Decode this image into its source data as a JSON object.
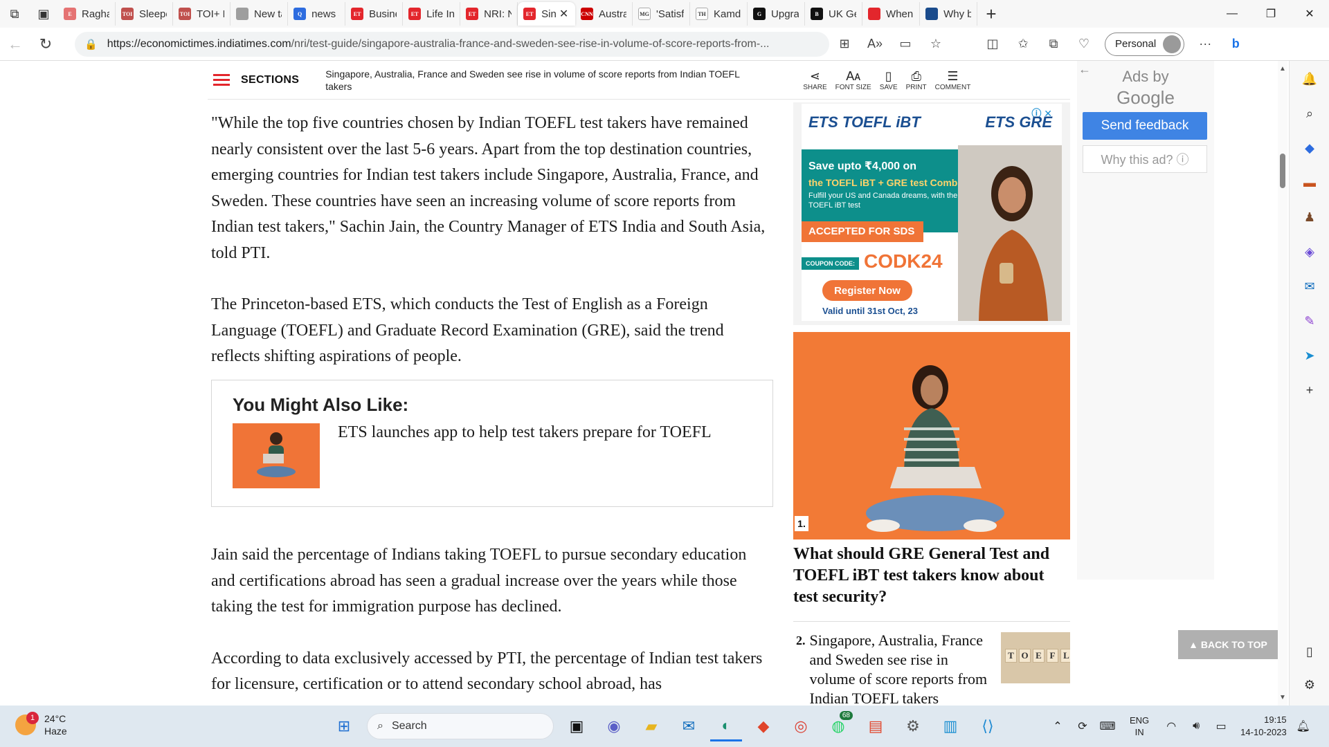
{
  "browser": {
    "tabs": [
      {
        "title": "Raghav",
        "fav_bg": "#e57373",
        "fav_text": "E"
      },
      {
        "title": "Sleeper",
        "fav_bg": "#c0504d",
        "fav_text": "TOI"
      },
      {
        "title": "TOI+ M",
        "fav_bg": "#c0504d",
        "fav_text": "TOI"
      },
      {
        "title": "New ta",
        "fav_bg": "#9e9e9e",
        "fav_text": ""
      },
      {
        "title": "news a",
        "fav_bg": "#2d6cdf",
        "fav_text": "Q"
      },
      {
        "title": "Busines",
        "fav_bg": "#e3262c",
        "fav_text": "ET"
      },
      {
        "title": "Life Ins",
        "fav_bg": "#e3262c",
        "fav_text": "ET"
      },
      {
        "title": "NRI: NF",
        "fav_bg": "#e3262c",
        "fav_text": "ET"
      },
      {
        "title": "Sin",
        "fav_bg": "#e3262c",
        "fav_text": "ET",
        "active": true
      },
      {
        "title": "Austral",
        "fav_bg": "#cc0000",
        "fav_text": "CNN"
      },
      {
        "title": "'Satisfa",
        "fav_bg": "#ffffff",
        "fav_text": "MG"
      },
      {
        "title": "Kamdu",
        "fav_bg": "#ffffff",
        "fav_text": "TH"
      },
      {
        "title": "Upgrac",
        "fav_bg": "#111111",
        "fav_text": "G"
      },
      {
        "title": "UK Geo",
        "fav_bg": "#111111",
        "fav_text": "B"
      },
      {
        "title": "When Z",
        "fav_bg": "#e3262c",
        "fav_text": ""
      },
      {
        "title": "Why bc",
        "fav_bg": "#1a4b8c",
        "fav_text": ""
      }
    ],
    "url_host": "https://economictimes.indiatimes.com",
    "url_path": "/nri/test-guide/singapore-australia-france-and-sweden-see-rise-in-volume-of-score-reports-from-...",
    "profile_label": "Personal"
  },
  "articlebar": {
    "sections_label": "SECTIONS",
    "headline": "Singapore, Australia, France and Sweden see rise in volume of score reports from Indian TOEFL takers",
    "tools": [
      {
        "icon": "share-icon",
        "glyph": "⋖",
        "label": "SHARE"
      },
      {
        "icon": "font-size-icon",
        "glyph": "Aᴀ",
        "label": "FONT SIZE"
      },
      {
        "icon": "bookmark-icon",
        "glyph": "▯",
        "label": "SAVE"
      },
      {
        "icon": "print-icon",
        "glyph": "⎙",
        "label": "PRINT"
      },
      {
        "icon": "comment-icon",
        "glyph": "☰",
        "label": "COMMENT"
      }
    ]
  },
  "article": {
    "p1": "\"While the top five countries chosen by Indian TOEFL test takers have remained nearly consistent over the last 5-6 years. Apart from the top destination countries, emerging countries for Indian test takers include Singapore, Australia, France, and Sweden. These countries have seen an increasing volume of score reports from Indian test takers,\" Sachin Jain, the Country Manager of ETS India and South Asia, told PTI.",
    "p2": "The Princeton-based ETS, which conducts the Test of English as a Foreign Language (TOEFL) and Graduate Record Examination (GRE), said the trend reflects shifting aspirations of people.",
    "p3": "Jain said the percentage of Indians taking TOEFL to pursue secondary education and certifications abroad has seen a gradual increase over the years while those taking the test for immigration purpose has declined.",
    "p4": "According to data exclusively accessed by PTI, the percentage of Indian test takers for licensure, certification or to attend secondary school abroad, has"
  },
  "might_like": {
    "heading": "You Might Also Like:",
    "link": "ETS launches app to help test takers prepare for TOEFL"
  },
  "ets_ad": {
    "choices": "ⓘ ✕",
    "logo_left": "ETS TOEFL iBT",
    "logo_right": "ETS GRE",
    "line1": "Save upto ₹4,000 on",
    "line2": "the TOEFL iBT + GRE test Combo",
    "line3": "Fulfill your US and Canada dreams, with the TOEFL iBT test",
    "accepted": "ACCEPTED FOR SDS",
    "coupon_label": "COUPON CODE:",
    "coupon": "CODK24",
    "register": "Register Now",
    "valid": "Valid until 31st Oct, 23"
  },
  "stories": {
    "s1_num": "1.",
    "s1_title": "What should GRE General Test and TOEFL iBT test takers know about test security?",
    "s2_num": "2.",
    "s2_title": "Singapore, Australia, France and Sweden see rise in volume of score reports from Indian TOEFL takers",
    "s2_tiles": [
      "T",
      "O",
      "E",
      "F",
      "L"
    ]
  },
  "google_panel": {
    "ads_by": "Ads by",
    "google": "Google",
    "feedback": "Send feedback",
    "why": "Why this ad? ⓘ"
  },
  "back_to_top": "▲ BACK TO TOP",
  "taskbar": {
    "weather_badge": "1",
    "temp": "24°C",
    "condition": "Haze",
    "search_label": "Search",
    "whatsapp_badge": "68",
    "lang1": "ENG",
    "lang2": "IN",
    "time": "19:15",
    "date": "14-10-2023"
  }
}
